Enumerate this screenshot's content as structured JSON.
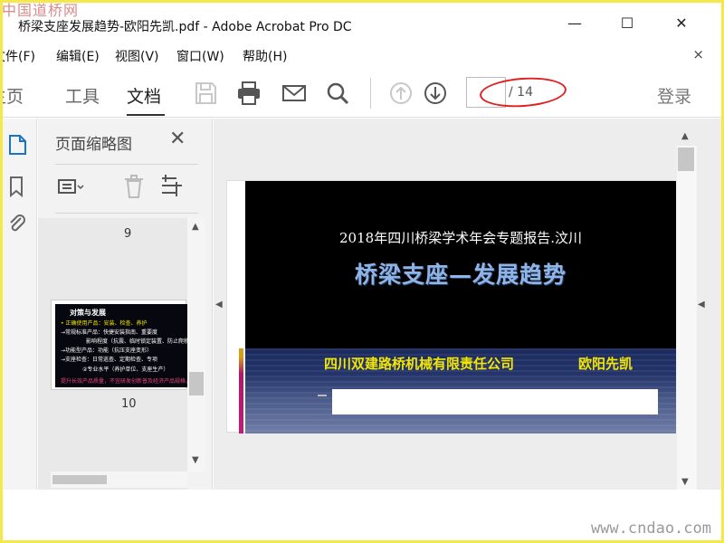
{
  "watermarks": {
    "top": "中国道桥网",
    "bottom": "www.cndao.com"
  },
  "window": {
    "title": "桥梁支座发展趋势-欧阳先凯.pdf - Adobe Acrobat Pro DC",
    "minimize": "—",
    "maximize": "☐",
    "close": "✕"
  },
  "menu": {
    "items": [
      "文件(F)",
      "编辑(E)",
      "视图(V)",
      "窗口(W)",
      "帮助(H)"
    ],
    "close": "×"
  },
  "toolbar": {
    "tabs": [
      "主页",
      "工具",
      "文档"
    ],
    "active_tab": "文档",
    "page_input": "",
    "page_total": "/ 14",
    "login": "登录",
    "icons": [
      "save-icon",
      "print-icon",
      "mail-icon",
      "search-icon",
      "page-up-icon",
      "page-down-icon"
    ]
  },
  "left_rail": {
    "icons": [
      "page-thumbnails-icon",
      "bookmark-icon",
      "attachment-icon"
    ]
  },
  "thumb_panel": {
    "title": "页面缩略图",
    "close": "✕",
    "tools": [
      "options-menu-icon",
      "delete-icon",
      "crop-icon"
    ],
    "pages": [
      {
        "number": "9"
      },
      {
        "number": "10",
        "title": "对策与发展",
        "lines": [
          {
            "text": "• 正确使用产品：安装、检查、养护",
            "color": "#f3e600"
          },
          {
            "text": "→常规标准产品：快捷安装指南、重要度",
            "color": "#ffffff"
          },
          {
            "text": "影响程度（抗震、临时锁定装置、防止爬移）",
            "color": "#ffffff"
          },
          {
            "text": "→功能型产品：功能（抗压支座变形）",
            "color": "#ffffff"
          },
          {
            "text": "→支座检查：日常巡查、定期检查、专项",
            "color": "#ffffff"
          },
          {
            "text": "②专业水平（养护单位、支座生产）",
            "color": "#ffffff"
          },
          {
            "text": "提升长效产品质量，不宜研发创新普及经济产品规格，外",
            "color": "#e0457a"
          }
        ]
      }
    ]
  },
  "slide": {
    "subtitle": "2018年四川桥梁学术年会专题报告.汶川",
    "title": "桥梁支座—发展趋势",
    "company": "四川双建路桥机械有限责任公司",
    "author": "欧阳先凯"
  },
  "colors": {
    "accent_yellow": "#f3e600",
    "title_blue": "#8fb4e6",
    "highlight_red": "#e02020"
  }
}
